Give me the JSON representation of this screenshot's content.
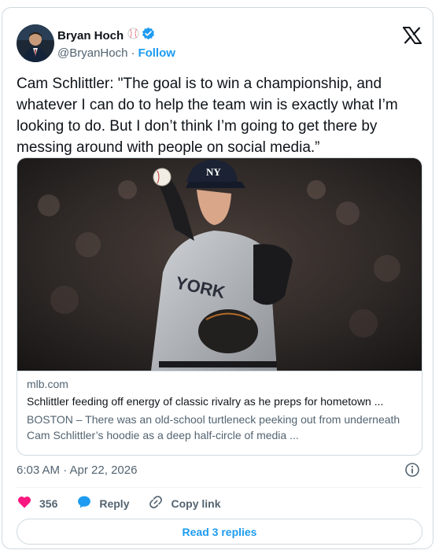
{
  "author": {
    "name": "Bryan Hoch",
    "handle": "@BryanHoch",
    "separator": "·",
    "follow_label": "Follow"
  },
  "icons": {
    "platform_logo": "x-logo-icon",
    "name_emoji": "baseball-icon",
    "verified": "verified-badge-icon",
    "info": "info-icon",
    "like": "heart-icon",
    "reply": "reply-bubble-icon",
    "copy_link": "link-icon"
  },
  "tweet": {
    "text": "Cam Schlittler: \"The goal is to win a championship, and whatever I can do to help the team win is exactly what I’m looking to do. But I don’t think I’m going to get there by messing around with people on social media.”"
  },
  "link_card": {
    "domain": "mlb.com",
    "title": "Schlittler feeding off energy of classic rivalry as he preps for hometown ...",
    "description": "BOSTON – There was an old-school turtleneck peeking out from underneath Cam Schlittler’s hoodie as a deep half-circle of media ..."
  },
  "timestamp": "6:03 AM · Apr 22, 2026",
  "actions": {
    "like_count": "356",
    "reply_label": "Reply",
    "copy_link_label": "Copy link"
  },
  "read_replies_label": "Read 3 replies",
  "colors": {
    "accent": "#1d9bf0",
    "like": "#f91880",
    "text": "#0f1419",
    "muted": "#536471",
    "border": "#cfd9de"
  }
}
